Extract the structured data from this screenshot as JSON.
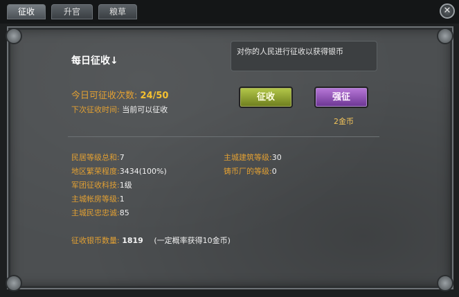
{
  "tabs": [
    {
      "label": "征收",
      "active": true
    },
    {
      "label": "升官",
      "active": false
    },
    {
      "label": "粮草",
      "active": false
    }
  ],
  "close_icon": "close-icon",
  "section": {
    "title": "每日征收↓"
  },
  "description": "对你的人民进行征收以获得银币",
  "collect": {
    "count_label": "今日可征收次数:",
    "count_value": "24/50",
    "next_label": "下次征收时间:",
    "next_value": "当前可以征收"
  },
  "buttons": {
    "collect": "征收",
    "force": "强征",
    "force_cost": "2金币"
  },
  "stats": [
    {
      "label": "民居等级总和:",
      "value": "7"
    },
    {
      "label": "地区繁荣程度:",
      "value": "3434(100%)"
    },
    {
      "label": "军团征收科技:",
      "value": "1级"
    },
    {
      "label": "主城帐房等级:",
      "value": "1"
    },
    {
      "label": "主城民忠忠诚:",
      "value": "85"
    }
  ],
  "stats_right": [
    {
      "label": "主城建筑等级:",
      "value": "30"
    },
    {
      "label": "铸币厂的等级:",
      "value": "0"
    }
  ],
  "yield": {
    "label": "征收银币数量:",
    "value": "1819",
    "note": "(一定概率获得10金币)"
  },
  "colors": {
    "accent_orange": "#e2a033",
    "collect_button": "#8fa12f",
    "force_button": "#8d4fb5",
    "panel_bg": "#4c4f51"
  }
}
